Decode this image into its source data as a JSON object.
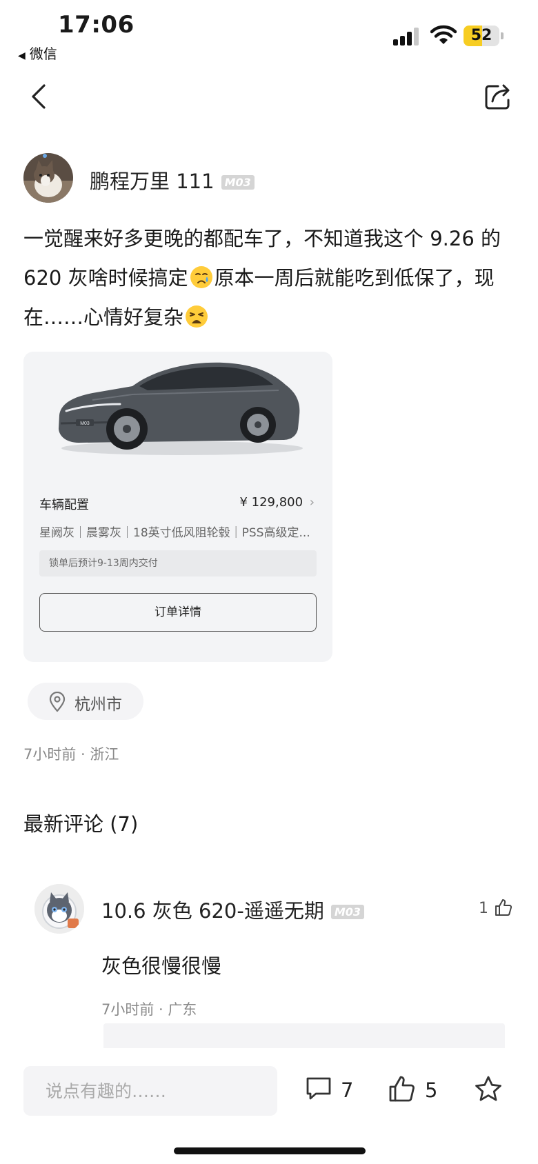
{
  "status_bar": {
    "time": "17:06",
    "back_app": "微信",
    "battery": "52",
    "battery_level": 0.52,
    "battery_color": "#f7cd22"
  },
  "nav": {
    "back_icon": "chevron-left-icon",
    "share_icon": "share-icon"
  },
  "post": {
    "author": "鹏程万里 111",
    "author_tag": "M03",
    "text_1": "一觉醒来好多更晚的都配车了，不知道我这个 9.26 的 620 灰啥时候搞定",
    "text_2": "原本一周后就能吃到低保了，现在……心情好复杂",
    "emoji_1": "crying-face-icon",
    "emoji_2": "weary-face-icon",
    "car_card": {
      "car_badge": "M03",
      "config_title": "车辆配置",
      "price": "¥ 129,800",
      "config_detail": "星阙灰｜晨雾灰｜18英寸低风阻轮毂｜PSS高级定...",
      "delivery_note": "锁单后预计9-13周内交付",
      "order_button": "订单详情"
    },
    "location": "杭州市",
    "meta": "7小时前 · 浙江"
  },
  "comments": {
    "title": "最新评论 (7)",
    "items": [
      {
        "name": "10.6 灰色 620-遥遥无期",
        "tag": "M03",
        "likes": "1",
        "text": "灰色很慢很慢",
        "meta": "7小时前 · 广东"
      }
    ]
  },
  "bottom_bar": {
    "input_placeholder": "说点有趣的……",
    "comment_count": "7",
    "like_count": "5",
    "accent": "#f7cd22"
  }
}
